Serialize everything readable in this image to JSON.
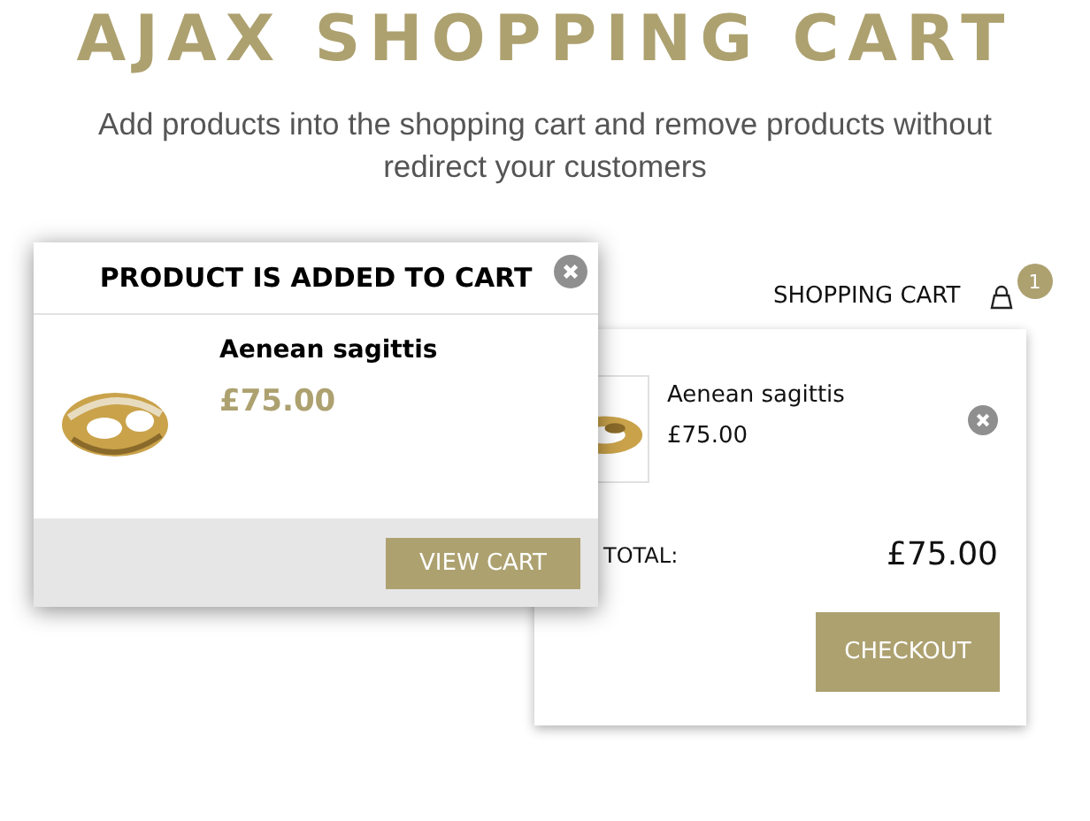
{
  "title": "AJAX SHOPPING CART",
  "subtitle": "Add products into the shopping cart and remove products without redirect your customers",
  "cart": {
    "label": "SHOPPING CART",
    "count": "1",
    "items": [
      {
        "kind": "picture",
        "name": "Aenean sagittis",
        "price": "£75.00"
      }
    ],
    "total_label": "TOTAL:",
    "total": "£75.00",
    "checkout": "CHECKOUT"
  },
  "popup": {
    "title": "PRODUCT IS ADDED TO CART",
    "product": {
      "kind": "picture",
      "name": "Aenean sagittis",
      "price": "£75.00"
    },
    "view_cart": "VIEW CART"
  }
}
